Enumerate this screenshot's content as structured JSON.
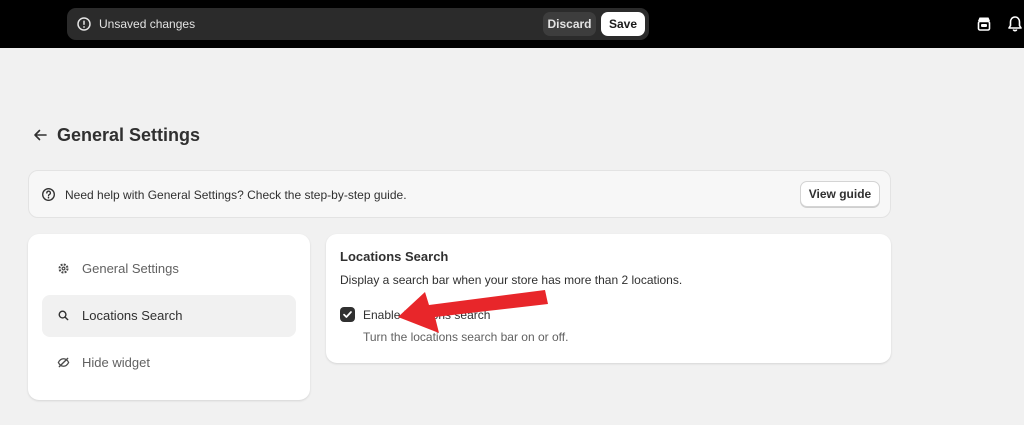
{
  "topbar": {
    "unsaved_text": "Unsaved changes",
    "discard_label": "Discard",
    "save_label": "Save",
    "icons": [
      "alert-circle-icon",
      "store-icon",
      "bell-icon"
    ]
  },
  "page": {
    "title": "General Settings"
  },
  "help_banner": {
    "text": "Need help with General Settings? Check the step-by-step guide.",
    "button_label": "View guide"
  },
  "sidebar": {
    "items": [
      {
        "label": "General Settings",
        "icon": "gear-icon",
        "active": false
      },
      {
        "label": "Locations Search",
        "icon": "search-icon",
        "active": true
      },
      {
        "label": "Hide widget",
        "icon": "eye-off-icon",
        "active": false
      }
    ]
  },
  "locations_search": {
    "title": "Locations Search",
    "description": "Display a search bar when your store has more than 2 locations.",
    "checkbox_label": "Enable locations search",
    "checkbox_checked": true,
    "checkbox_help": "Turn the locations search bar on or off."
  },
  "colors": {
    "topbar_bg": "#000000",
    "page_bg": "#f1f1f1",
    "annotation_arrow": "#e8262a"
  }
}
